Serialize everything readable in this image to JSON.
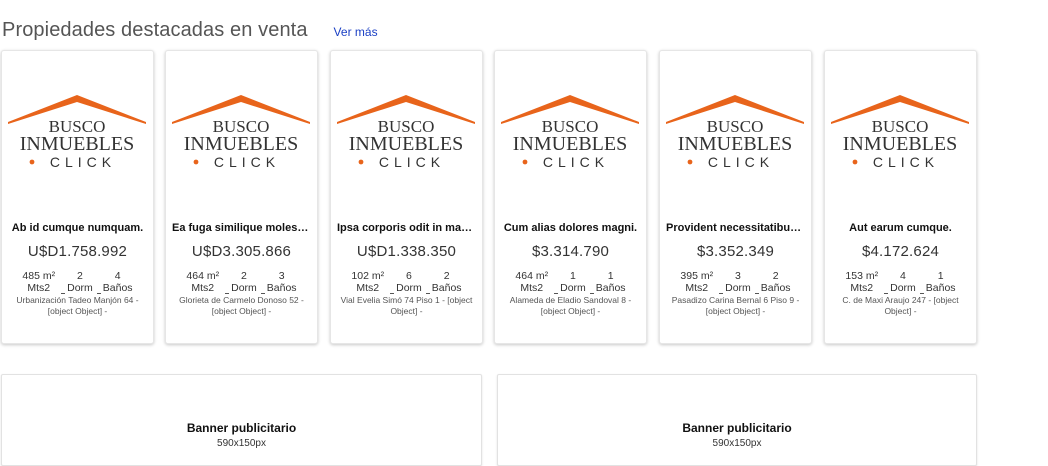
{
  "header": {
    "title": "Propiedades destacadas en venta",
    "more_link": "Ver más"
  },
  "logo": {
    "line1": "BUSCO",
    "line2": "INMUEBLES",
    "line3": "CLICK",
    "roof_color": "#e8641b",
    "text_color": "#333333",
    "dot_color": "#e8641b"
  },
  "cards": [
    {
      "title": "Ab id cumque numquam.",
      "price": "U$D1.758.992",
      "area": "485 m²",
      "area_unit": "Mts2",
      "dorm": "2",
      "dorm_label": "Dorm",
      "banos": "4",
      "banos_label": "Baños",
      "address": "Urbanización Tadeo Manjón 64 - [object Object] -"
    },
    {
      "title": "Ea fuga similique molest…",
      "price": "U$D3.305.866",
      "area": "464 m²",
      "area_unit": "Mts2",
      "dorm": "2",
      "dorm_label": "Dorm",
      "banos": "3",
      "banos_label": "Baños",
      "address": "Glorieta de Carmelo Donoso 52 - [object Object] -"
    },
    {
      "title": "Ipsa corporis odit in max…",
      "price": "U$D1.338.350",
      "area": "102 m²",
      "area_unit": "Mts2",
      "dorm": "6",
      "dorm_label": "Dorm",
      "banos": "2",
      "banos_label": "Baños",
      "address": "Vial Evelia Simó 74 Piso 1 - [object Object] -"
    },
    {
      "title": "Cum alias dolores magni.",
      "price": "$3.314.790",
      "area": "464 m²",
      "area_unit": "Mts2",
      "dorm": "1",
      "dorm_label": "Dorm",
      "banos": "1",
      "banos_label": "Baños",
      "address": "Alameda de Eladio Sandoval 8 - [object Object] -"
    },
    {
      "title": "Provident necessitatibus…",
      "price": "$3.352.349",
      "area": "395 m²",
      "area_unit": "Mts2",
      "dorm": "3",
      "dorm_label": "Dorm",
      "banos": "2",
      "banos_label": "Baños",
      "address": "Pasadizo Carina Bernal 6 Piso 9 - [object Object] -"
    },
    {
      "title": "Aut earum cumque.",
      "price": "$4.172.624",
      "area": "153 m²",
      "area_unit": "Mts2",
      "dorm": "4",
      "dorm_label": "Dorm",
      "banos": "1",
      "banos_label": "Baños",
      "address": "C. de Maxi Araujo 247 - [object Object] -"
    }
  ],
  "banners": [
    {
      "title": "Banner publicitario",
      "size": "590x150px"
    },
    {
      "title": "Banner publicitario",
      "size": "590x150px"
    }
  ]
}
